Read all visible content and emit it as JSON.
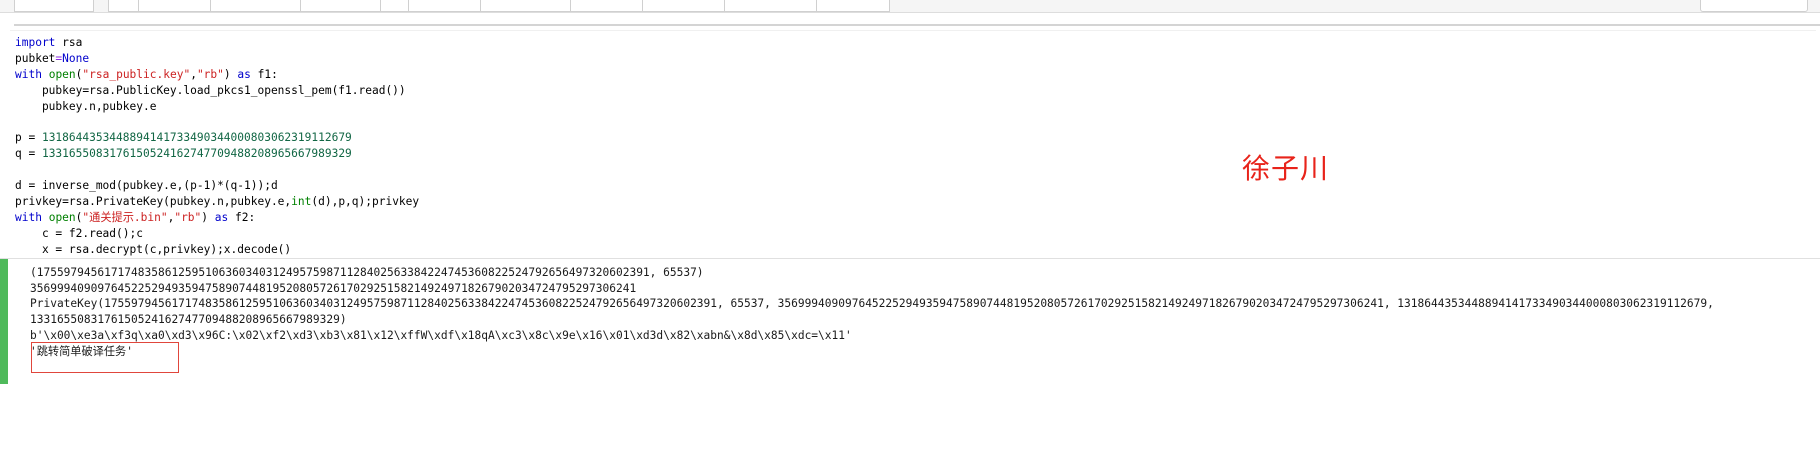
{
  "code": {
    "line1_kw": "import",
    "line1_rest": " rsa",
    "line2_a": "pubket",
    "line2_op": "=",
    "line2_b": "None",
    "line3_kw": "with",
    "line3_fn": "open",
    "line3_p1": "(",
    "line3_s1": "\"rsa_public.key\"",
    "line3_comma": ",",
    "line3_s2": "\"rb\"",
    "line3_p2": ")",
    "line3_as": "as",
    "line3_tail": " f1:",
    "line4": "    pubkey=rsa.PublicKey.load_pkcs1_openssl_pem(f1.read())",
    "line5": "    pubkey.n,pubkey.e",
    "line7_var": "p = ",
    "line7_num": "131864435344889414173349034400080306231911 2679",
    "p_value": "1318644353448894141733490344000803062319112679",
    "q_value": "1331655083176150524162747709488208965667989329",
    "line10": "d = inverse_mod(pubkey.e,(p-1)*(q-1));d",
    "line11_a": "privkey=rsa.PrivateKey(pubkey.n,pubkey.e,",
    "line11_fn": "int",
    "line11_b": "(d),p,q);privkey",
    "line12_s1": "\"通关提示.bin\"",
    "line12_tail": " f2:",
    "line13": "    c = f2.read();c",
    "line14": "    x = rsa.decrypt(c,privkey);x.decode()"
  },
  "watermark": "徐子川",
  "output": {
    "line1": "(1755979456171748358612595106360340312495759871128402563384224745360822524792656497320602391, 65537)",
    "line2": "3569994090976452252949359475890744819520805726170292515821492497182679020347247952973 06241",
    "line2_exact": "356999409097645225294935947589074481952080572617029251582149249718267902034724795297306241",
    "line3": "PrivateKey(1755979456171748358612595106360340312495759871128402563384224745360822524792656497320602391, 65537, 356999409097645225294935947589074481952080572617029251582149249718267902034724795297306241, 1318644353448894141733490344000803062319112679,",
    "line4": "1331655083176150524162747709488208965667989329)",
    "line5": "b'\\x00\\xe3a\\xf3q\\xa0\\xd3\\x96C:\\x02\\xf2\\xd3\\xb3\\x81\\x12\\xffW\\xdf\\x18qA\\xc3\\x8c\\x9e\\x16\\x01\\xd3d\\x82\\xabn&\\x8d\\x85\\xdc=\\x11'",
    "line6": "'跳转简单破译任务'"
  }
}
